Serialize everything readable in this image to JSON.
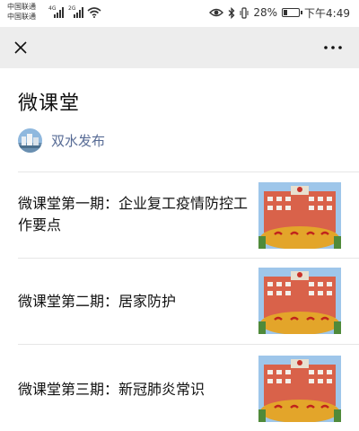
{
  "status": {
    "carrier_1": "中国联通",
    "carrier_2": "中国联通",
    "network_label": "4G",
    "network_label_2": "2G",
    "battery_percent": "28%",
    "battery_level": 0.28,
    "time": "下午4:49"
  },
  "nav": {
    "close_icon": "close-icon",
    "more_icon": "more-dots-icon"
  },
  "header": {
    "title": "微课堂",
    "author": "双水发布"
  },
  "articles": [
    {
      "title": "微课堂第一期：企业复工疫情防控工作要点"
    },
    {
      "title": "微课堂第二期：居家防护"
    },
    {
      "title": "微课堂第三期：新冠肺炎常识"
    }
  ],
  "colors": {
    "nav_bg": "#ededed",
    "link": "#576b95",
    "divider": "#e6e6e6"
  }
}
